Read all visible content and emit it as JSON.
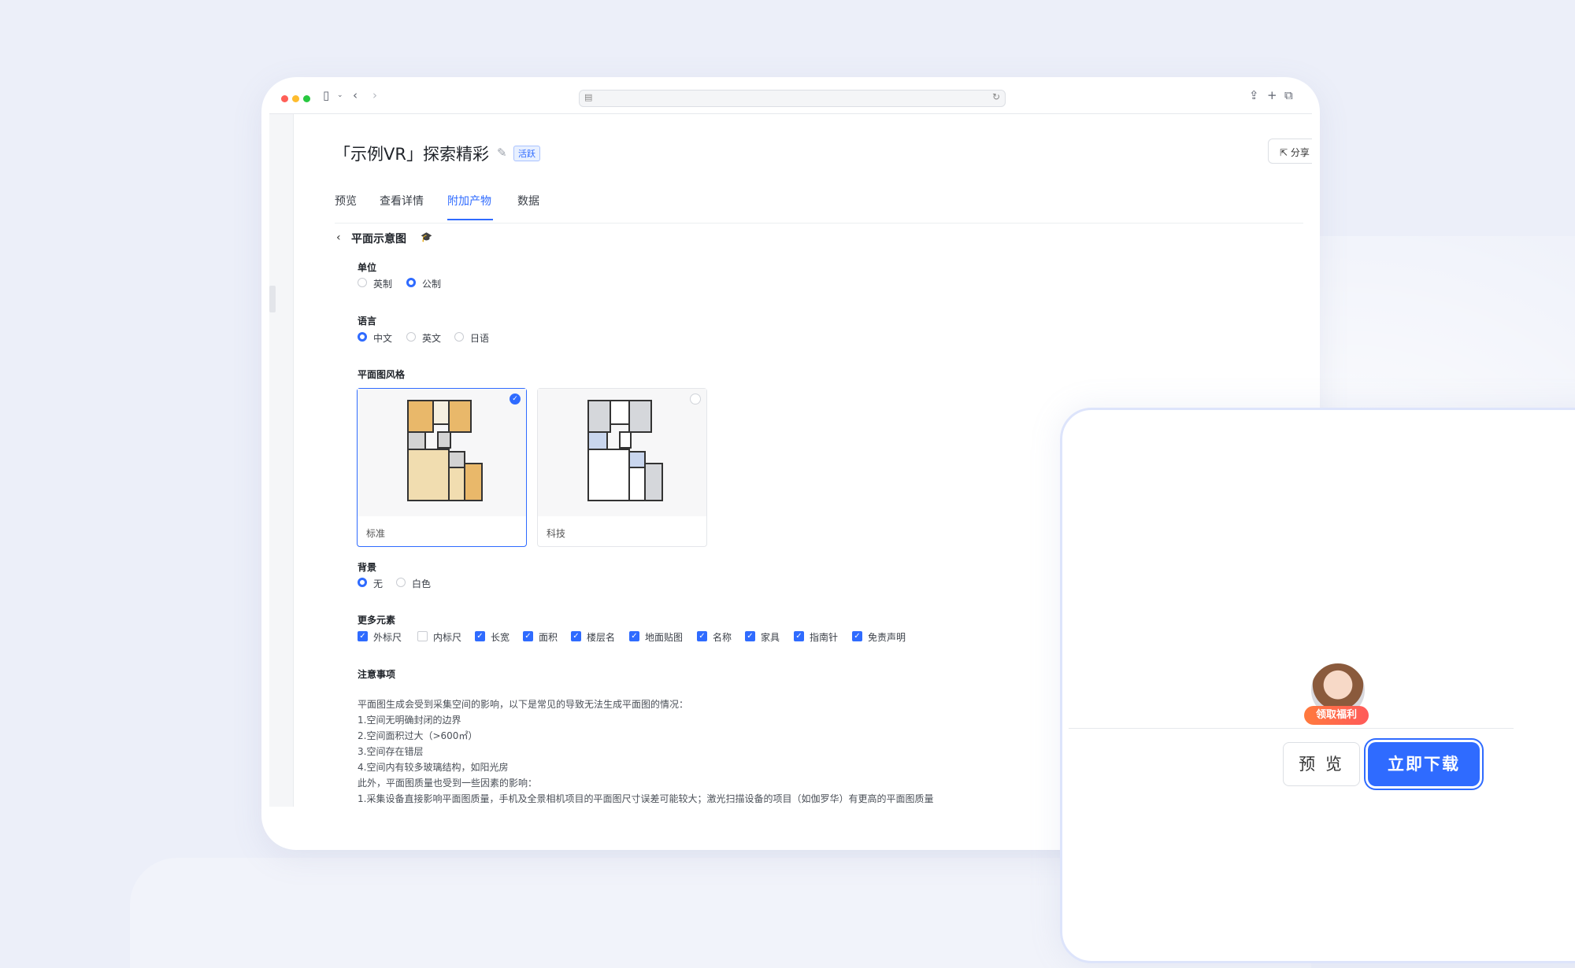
{
  "header": {
    "title": "「示例VR」探索精彩",
    "status_badge": "活跃",
    "share_label": "分享"
  },
  "tabs": [
    {
      "label": "预览"
    },
    {
      "label": "查看详情"
    },
    {
      "label": "附加产物",
      "active": true
    },
    {
      "label": "数据"
    }
  ],
  "section": {
    "title": "平面示意图"
  },
  "unit": {
    "label": "单位",
    "options": [
      "英制",
      "公制"
    ],
    "selected": "公制"
  },
  "language": {
    "label": "语言",
    "options": [
      "中文",
      "英文",
      "日语"
    ],
    "selected": "中文"
  },
  "floorplan_style": {
    "label": "平面图风格",
    "options": [
      {
        "label": "标准",
        "selected": true
      },
      {
        "label": "科技",
        "selected": false
      }
    ]
  },
  "background": {
    "label": "背景",
    "options": [
      "无",
      "白色"
    ],
    "selected": "无"
  },
  "more_elements": {
    "label": "更多元素",
    "items": [
      {
        "label": "外标尺",
        "checked": true
      },
      {
        "label": "内标尺",
        "checked": false
      },
      {
        "label": "长宽",
        "checked": true
      },
      {
        "label": "面积",
        "checked": true
      },
      {
        "label": "楼层名",
        "checked": true
      },
      {
        "label": "地面贴图",
        "checked": true
      },
      {
        "label": "名称",
        "checked": true
      },
      {
        "label": "家具",
        "checked": true
      },
      {
        "label": "指南针",
        "checked": true
      },
      {
        "label": "免责声明",
        "checked": true
      }
    ]
  },
  "notes": {
    "label": "注意事项",
    "lines": [
      "平面图生成会受到采集空间的影响，以下是常见的导致无法生成平面图的情况：",
      "1.空间无明确封闭的边界",
      "2.空间面积过大（>600㎡）",
      "3.空间存在错层",
      "4.空间内有较多玻璃结构，如阳光房",
      "此外，平面图质量也受到一些因素的影响：",
      "1.采集设备直接影响平面图质量，手机及全景相机项目的平面图尺寸误差可能较大；激光扫描设备的项目（如伽罗华）有更高的平面图质量"
    ]
  },
  "panel": {
    "bonus_badge": "领取福利",
    "preview_label": "预 览",
    "download_label": "立即下载"
  },
  "colors": {
    "accent": "#2f6bff",
    "page_bg": "#eceff9",
    "badge_orange": "#ff7a3d"
  }
}
